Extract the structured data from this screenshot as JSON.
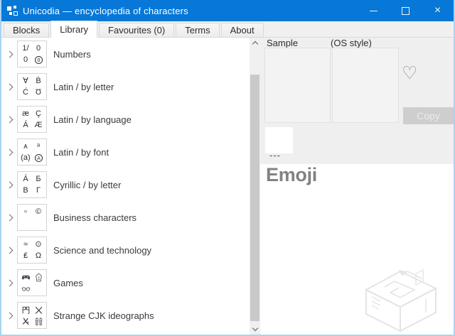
{
  "window": {
    "title": "Unicodia — encyclopedia of characters",
    "close_glyph": "×"
  },
  "colors": {
    "titlebar": "#0778d7",
    "window_border": "#a8d4f2",
    "heading_text": "#828282",
    "copy_button_bg": "#cecece"
  },
  "tabs": [
    {
      "label": "Blocks",
      "active": false
    },
    {
      "label": "Library",
      "active": true
    },
    {
      "label": "Favourites (0)",
      "active": false
    },
    {
      "label": "Terms",
      "active": false
    },
    {
      "label": "About",
      "active": false
    }
  ],
  "tree": {
    "items": [
      {
        "label": "Numbers",
        "cells": [
          {
            "t": "1/"
          },
          {
            "t": "0"
          },
          {
            "t": "0"
          },
          {
            "i": "circled-zero-icon"
          }
        ]
      },
      {
        "label": "Latin / by letter",
        "cells": [
          {
            "t": "∀"
          },
          {
            "t": "Ḃ"
          },
          {
            "t": "Ć"
          },
          {
            "t": "Ʊ"
          }
        ]
      },
      {
        "label": "Latin / by language",
        "cells": [
          {
            "t": "æ"
          },
          {
            "t": "Ç"
          },
          {
            "t": "Á"
          },
          {
            "t": "Æ"
          }
        ]
      },
      {
        "label": "Latin / by font",
        "cells": [
          {
            "t": "ᴀ"
          },
          {
            "t": "ᵃ"
          },
          {
            "t": "(a)"
          },
          {
            "i": "circled-a-icon"
          }
        ]
      },
      {
        "label": "Cyrillic / by letter",
        "cells": [
          {
            "t": "Á"
          },
          {
            "t": "Б"
          },
          {
            "t": "В"
          },
          {
            "t": "Г"
          }
        ]
      },
      {
        "label": "Business characters",
        "cells": [
          {
            "t": "▫"
          },
          {
            "t": "©"
          },
          {
            "t": ""
          },
          {
            "t": ""
          }
        ]
      },
      {
        "label": "Science and technology",
        "cells": [
          {
            "t": "≈"
          },
          {
            "t": "⊙"
          },
          {
            "t": "₤"
          },
          {
            "t": "Ω"
          }
        ]
      },
      {
        "label": "Games",
        "cells": [
          {
            "i": "gamepad-icon"
          },
          {
            "i": "shogi-piece-icon"
          },
          {
            "i": "glasses-icon"
          },
          {
            "t": ""
          }
        ]
      },
      {
        "label": "Strange CJK ideographs",
        "cells": [
          {
            "i": "cjk-gate-icon"
          },
          {
            "i": "cjk-x-icon"
          },
          {
            "i": "cjk-shime-icon"
          },
          {
            "i": "double-happiness-icon"
          }
        ]
      }
    ]
  },
  "preview": {
    "sample_label": "Sample",
    "os_style_label": "(OS style)",
    "heart_glyph": "♡",
    "copy_label": "Copy",
    "placeholder": "---",
    "heading": "Emoji"
  }
}
